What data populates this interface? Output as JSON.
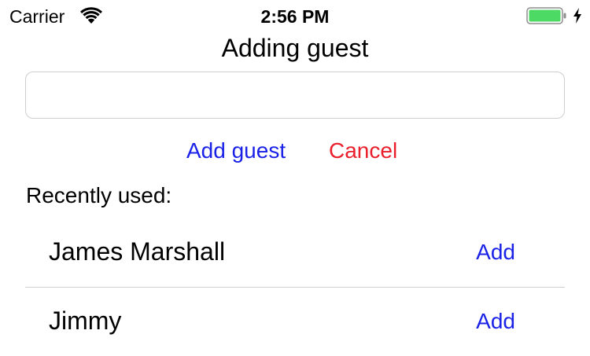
{
  "status_bar": {
    "carrier": "Carrier",
    "time": "2:56 PM",
    "wifi_icon": "wifi-icon",
    "battery_icon": "battery-icon",
    "battery_color": "#4cd964",
    "charging_icon": "charging-bolt-icon"
  },
  "title": "Adding guest",
  "name_input": {
    "value": "",
    "placeholder": ""
  },
  "actions": {
    "add_guest_label": "Add guest",
    "cancel_label": "Cancel",
    "add_color": "#1a22e8",
    "cancel_color": "#ea1f2b"
  },
  "recent": {
    "label": "Recently used:",
    "items": [
      {
        "name": "James Marshall",
        "action": "Add"
      },
      {
        "name": "Jimmy",
        "action": "Add"
      }
    ]
  }
}
